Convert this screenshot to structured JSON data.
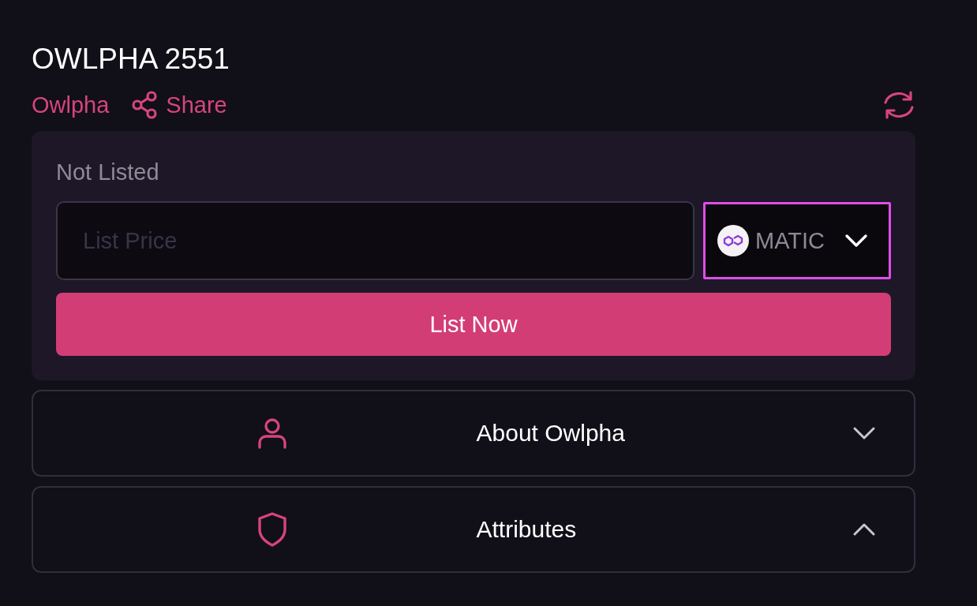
{
  "title": "OWLPHA 2551",
  "collection_link": "Owlpha",
  "share_link": "Share",
  "listing": {
    "status": "Not Listed",
    "price_field": {
      "placeholder": "List Price"
    },
    "currency": {
      "label": "MATIC",
      "focused": true
    },
    "button": "List Now"
  },
  "sections": [
    {
      "kind": "person",
      "label": "About Owlpha",
      "expanded": false
    },
    {
      "kind": "shield",
      "label": "Attributes",
      "expanded": true
    }
  ]
}
